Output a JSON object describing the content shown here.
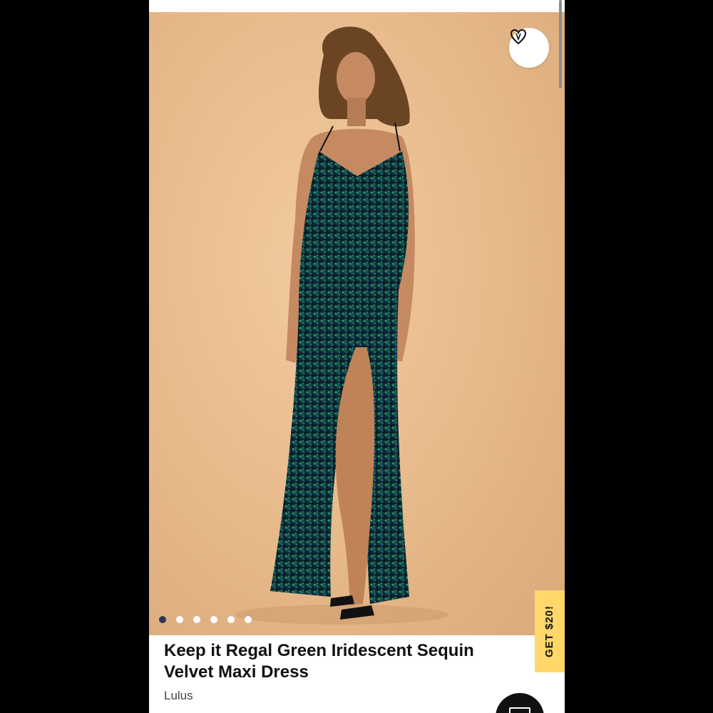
{
  "product": {
    "title": "Keep it Regal Green Iridescent Sequin Velvet Maxi Dress",
    "brand": "Lulus"
  },
  "gallery": {
    "image_alt": "model wearing green iridescent sequin maxi dress",
    "dot_count": 6,
    "active_index": 0
  },
  "promo": {
    "label": "GET $20!"
  },
  "icons": {
    "favorite": "heart-icon",
    "chat": "chat-icon"
  },
  "colors": {
    "accent_promo": "#ffd76a",
    "background": "#e6b98a",
    "dress": "#0f3a3a"
  }
}
